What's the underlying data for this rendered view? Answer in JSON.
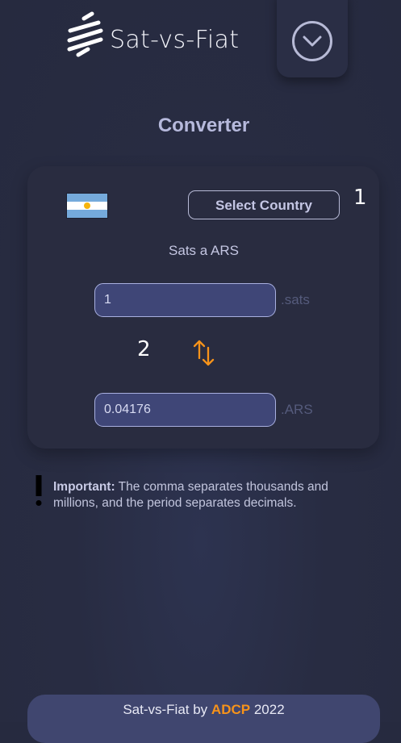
{
  "header": {
    "app_title": "Sat-vs-Fiat",
    "logo_icon": "bitcoin-stripes-logo",
    "menu_icon": "chevron-down-circle-icon"
  },
  "main": {
    "heading": "Converter",
    "country": {
      "flag_icon": "argentina-flag-icon",
      "select_label": "Select Country"
    },
    "conversion_label": "Sats a ARS",
    "sats_field": {
      "value": "1",
      "unit": ".sats"
    },
    "fiat_field": {
      "value": "0.04176",
      "unit": ".ARS"
    },
    "swap_icon": "swap-arrows-icon"
  },
  "annotations": {
    "marker_1": "1",
    "marker_2": "2"
  },
  "note": {
    "label": "Important:",
    "text": "The comma separates thousands and millions, and the period separates decimals."
  },
  "footer": {
    "prefix": "Sat-vs-Fiat by",
    "brand": "ADCP",
    "year": "2022"
  },
  "colors": {
    "accent": "#f7931a",
    "background": "#282c42",
    "field": "#3f4677"
  }
}
